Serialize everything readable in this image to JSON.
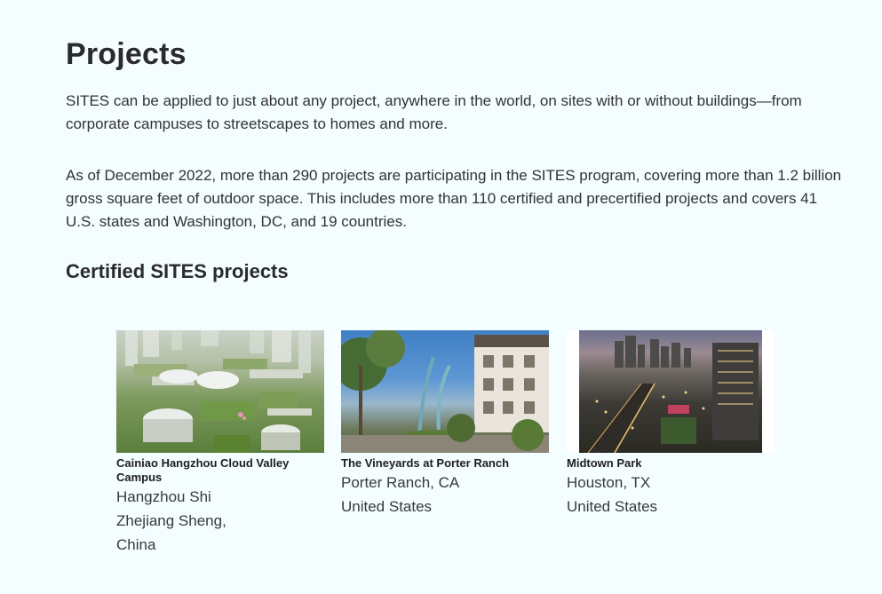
{
  "page": {
    "title": "Projects",
    "paragraphs": [
      "SITES can be applied to just about any project, anywhere in the world, on sites with or without buildings—from corporate campuses to streetscapes to homes and more.",
      "As of December 2022, more than 290 projects are participating in the SITES program, covering more than 1.2 billion gross square feet of outdoor space. This includes more than 110 certified and precertified projects and covers 41 U.S. states and Washington, DC, and 19 countries."
    ],
    "section_heading": "Certified SITES projects"
  },
  "projects": [
    {
      "name": "Cainiao Hangzhou Cloud Valley Campus",
      "location_lines": [
        "Hangzhou Shi",
        "Zhejiang Sheng,",
        "China"
      ]
    },
    {
      "name": "The Vineyards at Porter Ranch",
      "location_lines": [
        "Porter Ranch, CA",
        "United States"
      ]
    },
    {
      "name": "Midtown Park",
      "location_lines": [
        "Houston, TX",
        "United States"
      ]
    }
  ],
  "colors": {
    "background": "#f4fdff",
    "text": "#2d2d2d"
  }
}
